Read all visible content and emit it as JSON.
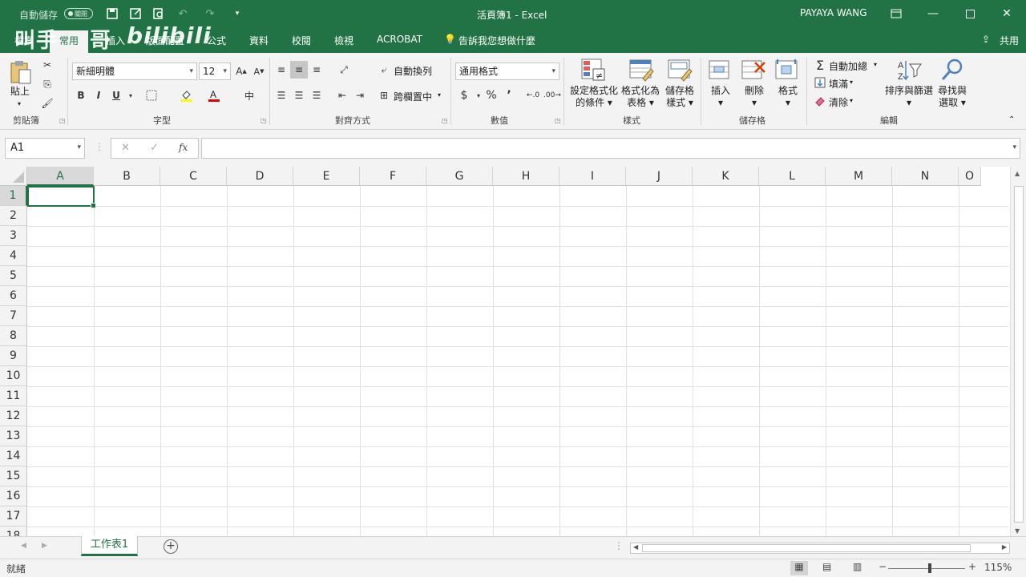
{
  "titlebar": {
    "autosave_label": "自動儲存",
    "autosave_state": "關閉",
    "title": "活頁簿1 - Excel",
    "user": "PAYAYA WANG",
    "colors": {
      "brand": "#217346"
    }
  },
  "menu": {
    "tabs": [
      "檔案",
      "常用",
      "插入",
      "版面配置",
      "公式",
      "資料",
      "校閱",
      "檢視",
      "ACROBAT"
    ],
    "tell_me": "告訴我您想做什麼",
    "share": "共用"
  },
  "watermark": {
    "text1": "叫手",
    "text2": "哥",
    "text3": "bilibili"
  },
  "ribbon": {
    "clipboard": {
      "label": "剪貼簿",
      "paste": "貼上"
    },
    "font": {
      "label": "字型",
      "font_name": "新細明體",
      "font_size": "12",
      "bold": "B",
      "italic": "I",
      "underline": "U"
    },
    "alignment": {
      "label": "對齊方式",
      "wrap_text": "自動換列",
      "merge_center": "跨欄置中"
    },
    "number": {
      "label": "數值",
      "format": "通用格式",
      "currency": "$",
      "percent": "%",
      "comma": "’"
    },
    "styles": {
      "label": "樣式",
      "conditional_1": "設定格式化",
      "conditional_2": "的條件",
      "table_1": "格式化為",
      "table_2": "表格",
      "cell_1": "儲存格",
      "cell_2": "樣式"
    },
    "cells": {
      "label": "儲存格",
      "insert": "插入",
      "delete": "刪除",
      "format": "格式"
    },
    "editing": {
      "label": "編輯",
      "autosum": "自動加總",
      "fill": "填滿",
      "clear": "清除",
      "sort_filter": "排序與篩選",
      "find_1": "尋找與",
      "find_2": "選取"
    }
  },
  "formula_bar": {
    "name_box": "A1",
    "fx": "fx",
    "value": ""
  },
  "grid": {
    "columns": [
      "A",
      "B",
      "C",
      "D",
      "E",
      "F",
      "G",
      "H",
      "I",
      "J",
      "K",
      "L",
      "M",
      "N",
      "O"
    ],
    "rows": [
      "1",
      "2",
      "3",
      "4",
      "5",
      "6",
      "7",
      "8",
      "9",
      "10",
      "11",
      "12",
      "13",
      "14",
      "15",
      "16",
      "17",
      "18"
    ],
    "selected_cell": "A1"
  },
  "sheets": {
    "tabs": [
      "工作表1"
    ],
    "add": "+"
  },
  "status": {
    "ready": "就緒",
    "zoom": "115%"
  }
}
